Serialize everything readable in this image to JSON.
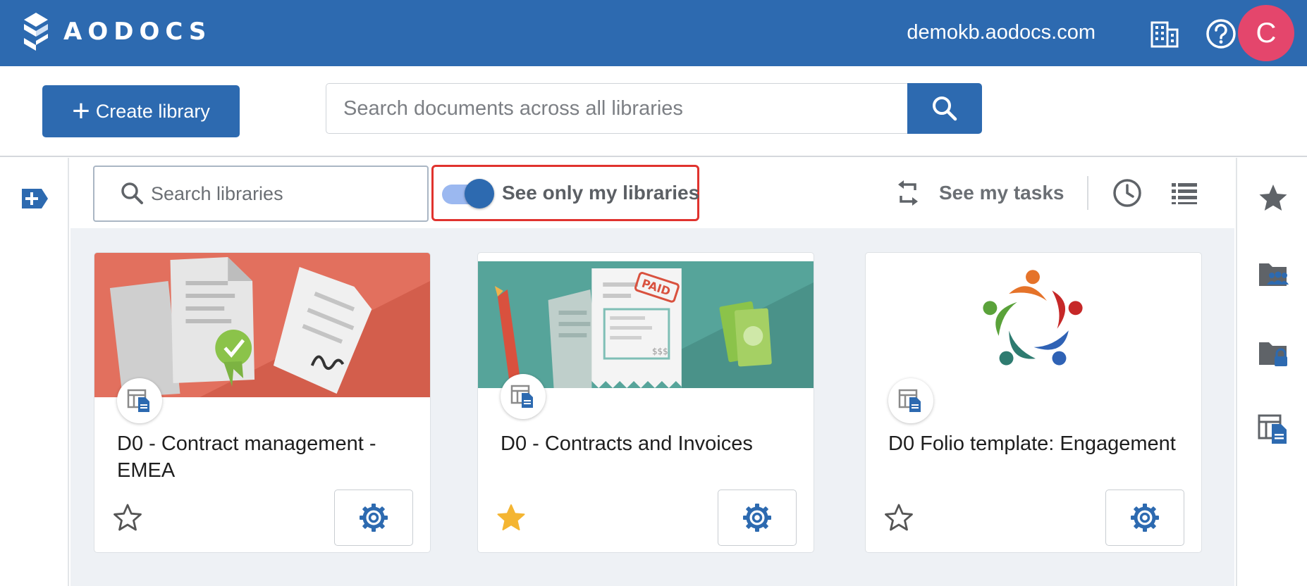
{
  "topbar": {
    "brand": "AODOCS",
    "domain": "demokb.aodocs.com",
    "avatar_initial": "C",
    "icons": [
      "domain-icon",
      "help-icon"
    ],
    "colors": {
      "bar": "#2d6ab0",
      "avatar": "#e4466c"
    }
  },
  "header": {
    "create_label": "Create library",
    "create_icon": "plus-icon",
    "search_placeholder": "Search documents across all libraries",
    "search_icon": "search-icon"
  },
  "left_rail": {
    "icons": [
      "add-tag-icon"
    ]
  },
  "toolbar": {
    "library_search_placeholder": "Search libraries",
    "toggle_label": "See only my libraries",
    "toggle_on": true,
    "tasks_label": "See my tasks",
    "icons": [
      "sync-icon",
      "clock-icon",
      "list-view-icon"
    ]
  },
  "right_rail": {
    "icons": [
      "star-icon",
      "shared-folder-icon",
      "locked-folder-icon",
      "library-doc-icon"
    ]
  },
  "cards": [
    {
      "title": "D0 - Contract management - EMEA",
      "starred": false,
      "banner": "contracts-illustration",
      "banner_color": "#e2705e"
    },
    {
      "title": "D0 - Contracts and Invoices",
      "starred": true,
      "banner": "invoices-illustration",
      "banner_color": "#56a49a"
    },
    {
      "title": "D0 Folio template: Engagement",
      "starred": false,
      "banner": "people-circle-logo",
      "banner_color": "#ffffff"
    }
  ],
  "colors": {
    "accent": "#2d6ab0",
    "highlight_border": "#e0332e",
    "star_filled": "#f4b532",
    "star_empty": "#555555"
  }
}
